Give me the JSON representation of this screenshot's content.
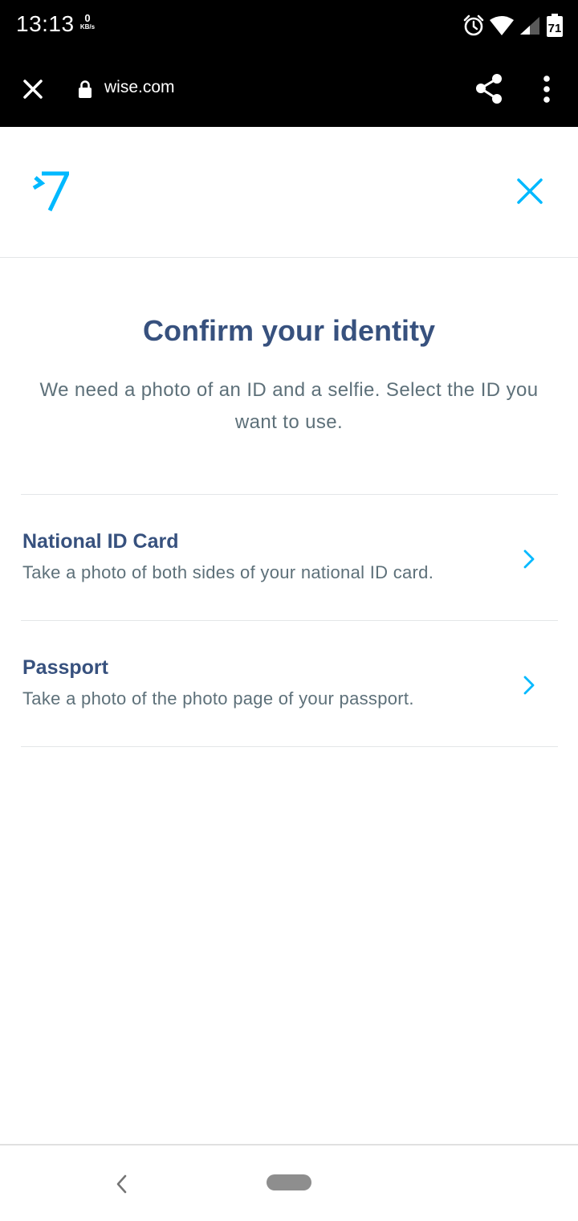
{
  "status_bar": {
    "time": "13:13",
    "net_speed_value": "0",
    "net_speed_unit": "KB/s",
    "battery_level": "71"
  },
  "browser": {
    "url": "wise.com",
    "close_icon": "close-icon",
    "lock_icon": "lock-icon",
    "share_icon": "share-icon",
    "menu_icon": "more-vert-icon"
  },
  "header": {
    "logo": "wise-logo",
    "close_icon": "close-icon",
    "accent_color": "#00b9ff"
  },
  "main": {
    "title": "Confirm your identity",
    "subtitle": "We need a photo of an ID and a selfie. Select the ID you want to use.",
    "options": [
      {
        "title": "National ID Card",
        "description": "Take a photo of both sides of your national ID card."
      },
      {
        "title": "Passport",
        "description": "Take a photo of the photo page of your passport."
      }
    ]
  },
  "colors": {
    "title": "#37517e",
    "body_text": "#5d7079",
    "accent": "#00b9ff",
    "divider": "#e4e6e8"
  }
}
